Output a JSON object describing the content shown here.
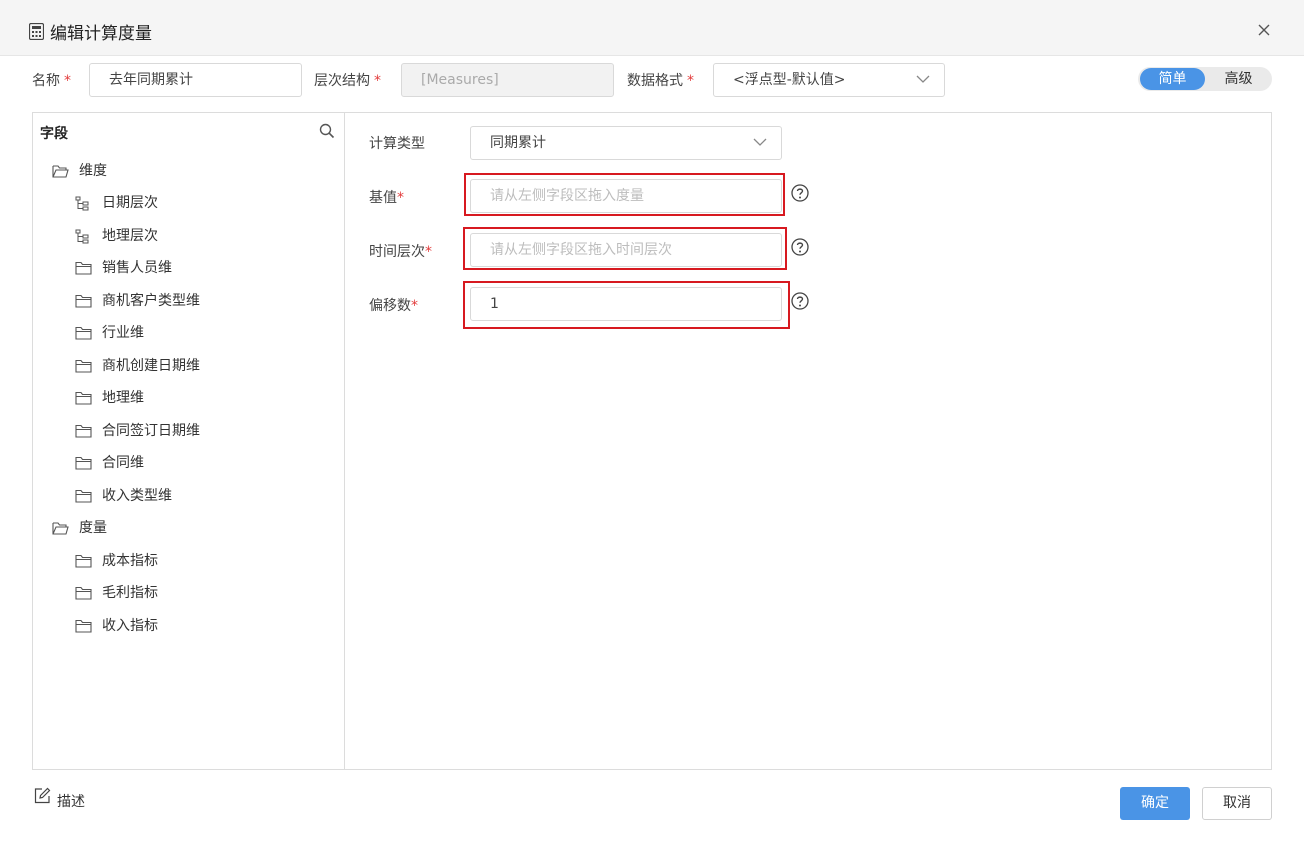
{
  "dialog": {
    "title": "编辑计算度量"
  },
  "form": {
    "name_label": "名称",
    "name_value": "去年同期累计",
    "hierarchy_label": "层次结构",
    "hierarchy_value": "[Measures]",
    "format_label": "数据格式",
    "format_value": "<浮点型-默认值>",
    "required_mark": "*"
  },
  "mode_toggle": {
    "simple": "简单",
    "advanced": "高级",
    "active": "simple"
  },
  "fields": {
    "header": "字段",
    "groups": [
      {
        "label": "维度",
        "items": [
          {
            "label": "日期层次",
            "icon": "hierarchy-icon"
          },
          {
            "label": "地理层次",
            "icon": "hierarchy-icon"
          },
          {
            "label": "销售人员维",
            "icon": "folder-icon"
          },
          {
            "label": "商机客户类型维",
            "icon": "folder-icon"
          },
          {
            "label": "行业维",
            "icon": "folder-icon"
          },
          {
            "label": "商机创建日期维",
            "icon": "folder-icon"
          },
          {
            "label": "地理维",
            "icon": "folder-icon"
          },
          {
            "label": "合同签订日期维",
            "icon": "folder-icon"
          },
          {
            "label": "合同维",
            "icon": "folder-icon"
          },
          {
            "label": "收入类型维",
            "icon": "folder-icon"
          }
        ]
      },
      {
        "label": "度量",
        "items": [
          {
            "label": "成本指标",
            "icon": "folder-icon"
          },
          {
            "label": "毛利指标",
            "icon": "folder-icon"
          },
          {
            "label": "收入指标",
            "icon": "folder-icon"
          }
        ]
      }
    ]
  },
  "calc": {
    "type_label": "计算类型",
    "type_value": "同期累计",
    "base_label": "基值",
    "base_placeholder": "请从左侧字段区拖入度量",
    "time_label": "时间层次",
    "time_placeholder": "请从左侧字段区拖入时间层次",
    "offset_label": "偏移数",
    "offset_value": "1"
  },
  "footer": {
    "describe": "描述",
    "ok": "确定",
    "cancel": "取消"
  },
  "colors": {
    "accent": "#4a94e6",
    "highlight": "#d71920",
    "required": "#e23b3b"
  }
}
